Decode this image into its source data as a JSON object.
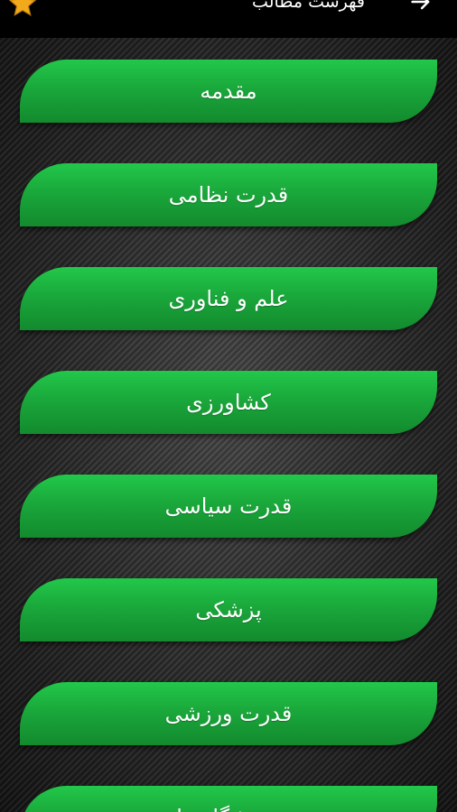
{
  "header": {
    "title": "فهرست مطالب",
    "favorite_icon": "star-icon",
    "back_icon": "arrow-right-icon"
  },
  "colors": {
    "header_background": "#000000",
    "button_green": "#1aa83b",
    "star_gold": "#f2a91b"
  },
  "menu": {
    "items": [
      {
        "label": "مقدمه"
      },
      {
        "label": "قدرت نظامی"
      },
      {
        "label": "علم و فناوری"
      },
      {
        "label": "کشاورزی"
      },
      {
        "label": "قدرت سیاسی"
      },
      {
        "label": "پزشکی"
      },
      {
        "label": "قدرت ورزشی"
      },
      {
        "label": "ورزشگاه ها"
      }
    ]
  }
}
